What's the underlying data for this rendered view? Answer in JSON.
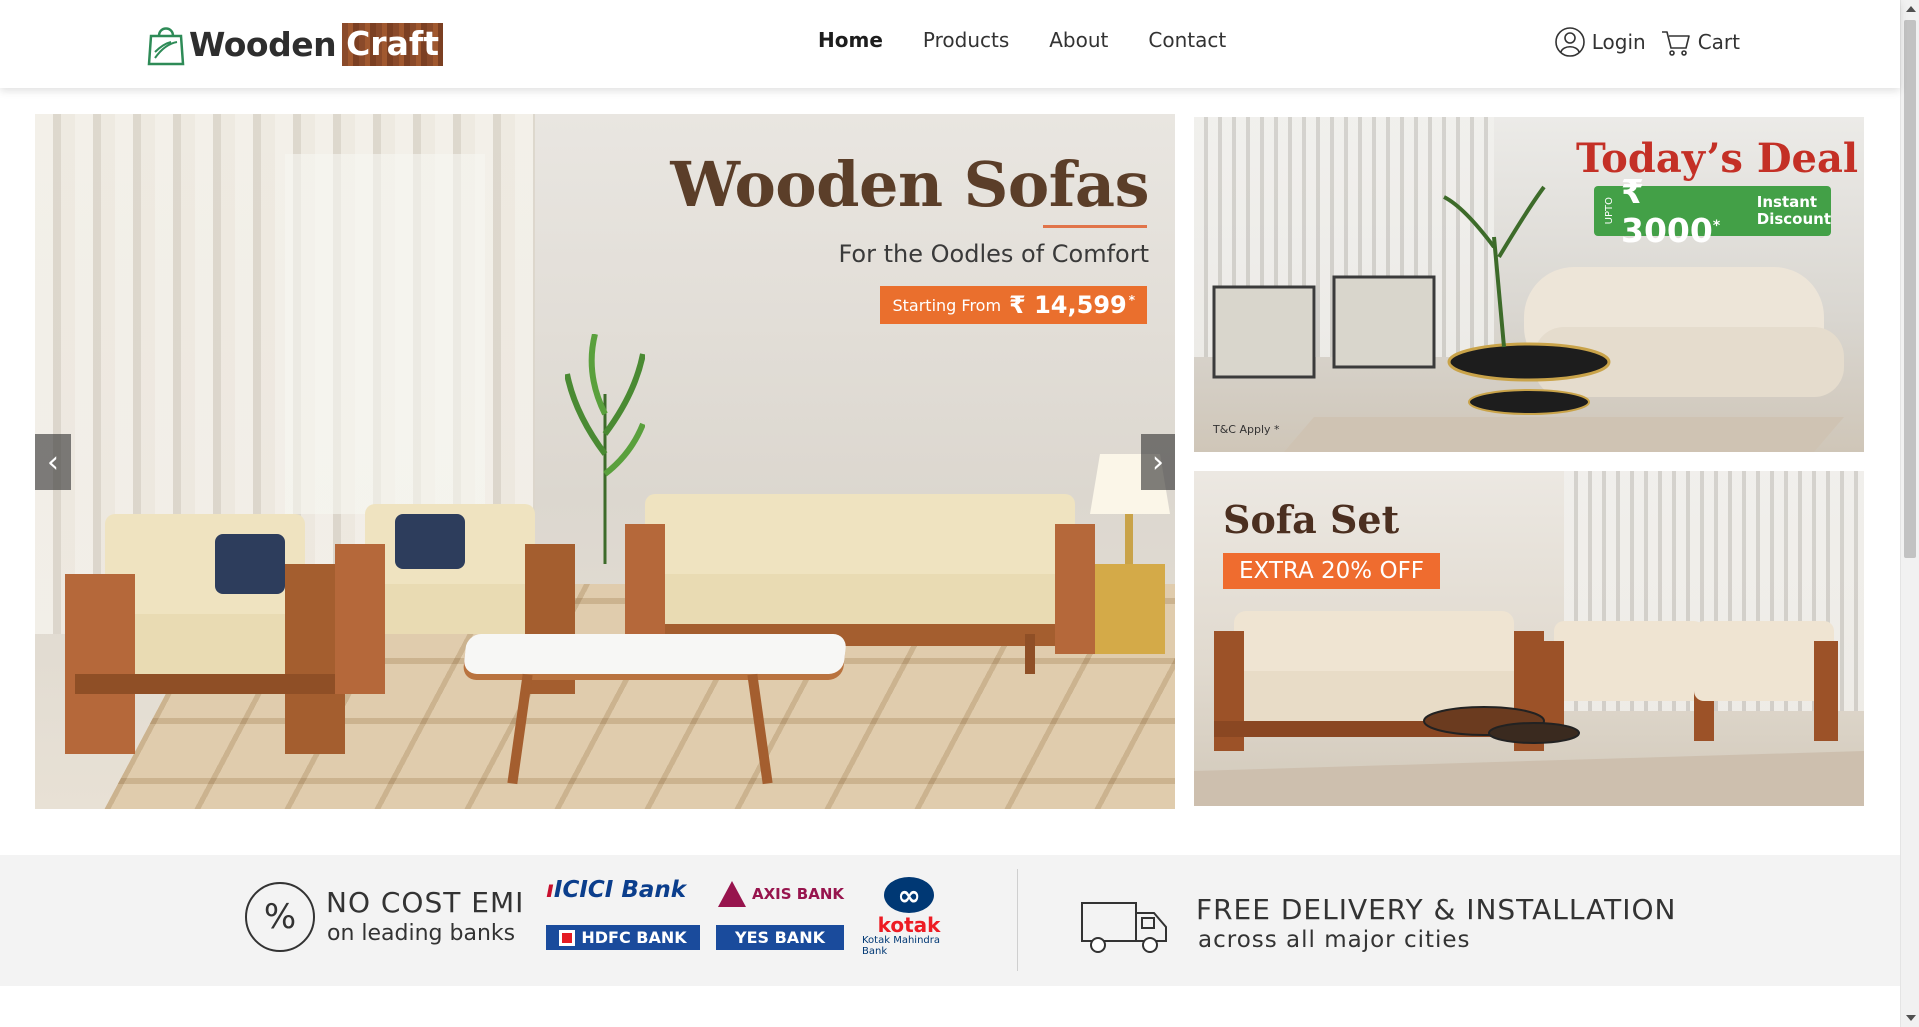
{
  "brand": {
    "name_part1": "Wooden",
    "name_part2": "Craft"
  },
  "nav": {
    "items": [
      {
        "label": "Home",
        "active": true
      },
      {
        "label": "Products",
        "active": false
      },
      {
        "label": "About",
        "active": false
      },
      {
        "label": "Contact",
        "active": false
      }
    ]
  },
  "user": {
    "login_label": "Login",
    "cart_label": "Cart"
  },
  "hero": {
    "title": "Wooden Sofas",
    "subtitle": "For the Oodles of Comfort",
    "price_label": "Starting From",
    "price": "₹ 14,599",
    "price_mark": "*",
    "prev_arrow": "‹",
    "next_arrow": "›"
  },
  "deal_banner": {
    "title": "Today’s Deal",
    "upto": "UPTO",
    "amount": "₹ 3000",
    "amount_mark": "*",
    "note_line1": "Instant",
    "note_line2": "Discount",
    "terms": "T&C Apply *"
  },
  "sofa_set_banner": {
    "title": "Sofa Set",
    "offer": "EXTRA 20% OFF"
  },
  "info_strip": {
    "emi_icon": "%",
    "emi_heading": "NO COST EMI",
    "emi_sub": "on leading banks",
    "banks": {
      "icici": "ICICI Bank",
      "hdfc": "HDFC BANK",
      "axis": "AXIS BANK",
      "yes": "YES BANK",
      "kotak": "kotak",
      "kotak_sub": "Kotak Mahindra Bank"
    },
    "delivery_heading": "FREE DELIVERY & INSTALLATION",
    "delivery_sub": "across all major cities"
  },
  "colors": {
    "accent_orange": "#ea6f2d",
    "deal_red": "#c43026",
    "deal_green": "#43a047",
    "hero_title": "#5b3e29"
  },
  "icons": [
    "shopping-bag-logo-icon",
    "user-icon",
    "cart-icon",
    "percent-icon",
    "truck-icon"
  ]
}
